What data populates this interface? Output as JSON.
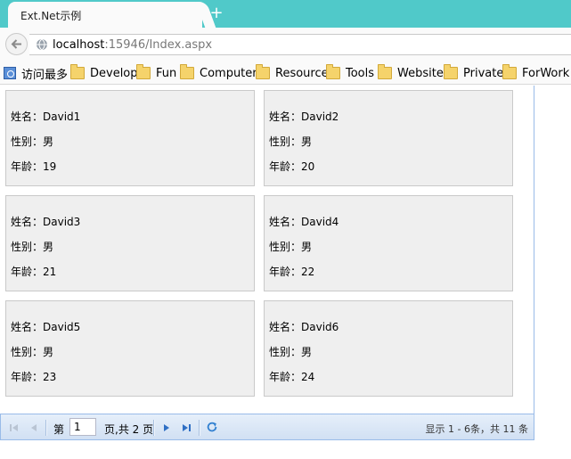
{
  "browser": {
    "tab_title": "Ext.Net示例",
    "new_tab": "+",
    "url_host": "localhost",
    "url_rest": ":15946/Index.aspx"
  },
  "bookmarks": [
    {
      "label": "访问最多",
      "icon": "visited-icon"
    },
    {
      "label": "Develop",
      "icon": "folder-icon"
    },
    {
      "label": "Fun",
      "icon": "folder-icon"
    },
    {
      "label": "Computer",
      "icon": "folder-icon"
    },
    {
      "label": "Resource",
      "icon": "folder-icon"
    },
    {
      "label": "Tools",
      "icon": "folder-icon"
    },
    {
      "label": "Website",
      "icon": "folder-icon"
    },
    {
      "label": "Private",
      "icon": "folder-icon"
    },
    {
      "label": "ForWork",
      "icon": "folder-icon"
    }
  ],
  "cards": [
    {
      "name": "姓名：David1",
      "gender": "性别：男",
      "age": "年龄：19"
    },
    {
      "name": "姓名：David2",
      "gender": "性别：男",
      "age": "年龄：20"
    },
    {
      "name": "姓名：David3",
      "gender": "性别：男",
      "age": "年龄：21"
    },
    {
      "name": "姓名：David4",
      "gender": "性别：男",
      "age": "年龄：22"
    },
    {
      "name": "姓名：David5",
      "gender": "性别：男",
      "age": "年龄：23"
    },
    {
      "name": "姓名：David6",
      "gender": "性别：男",
      "age": "年龄：24"
    }
  ],
  "pager": {
    "page_prefix": "第",
    "page_value": "1",
    "page_suffix": "页,共 2 页",
    "display_info": "显示 1 - 6条，共 11 条"
  },
  "colors": {
    "tab_strip": "#50c9c9",
    "pager_border": "#99bbe8",
    "card_bg": "#efefef"
  }
}
